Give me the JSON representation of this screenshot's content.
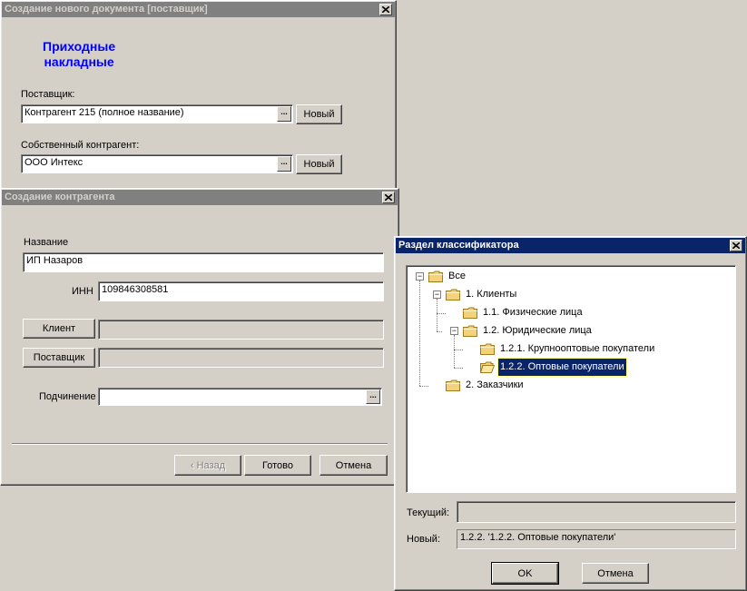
{
  "doc_window": {
    "title": "Создание нового документа [поставщик]",
    "heading": "Приходные\nнакладные",
    "supplier_label": "Поставщик:",
    "supplier_value": "Контрагент 215 (полное название)",
    "own_label": "Собственный контрагент:",
    "own_value": "ООО Интекс",
    "new_label": "Новый",
    "ellipsis": "..."
  },
  "contractor_window": {
    "title": "Создание контрагента",
    "name_label": "Название",
    "name_value": "ИП Назаров",
    "inn_label": "ИНН",
    "inn_value": "109846308581",
    "client_button": "Клиент",
    "supplier_button": "Поставщик",
    "subordination_label": "Подчинение",
    "back_button": "‹ Назад",
    "finish_button": "Готово",
    "cancel_button": "Отмена",
    "ellipsis": "..."
  },
  "classifier_window": {
    "title": "Раздел классификатора",
    "tree": [
      {
        "label": "Все",
        "level": 0,
        "expander": "−"
      },
      {
        "label": "1. Клиенты",
        "level": 1,
        "expander": "−"
      },
      {
        "label": "1.1. Физические лица",
        "level": 2,
        "expander": ""
      },
      {
        "label": "1.2. Юридические лица",
        "level": 2,
        "expander": "−"
      },
      {
        "label": "1.2.1. Крупнооптовые покупатели",
        "level": 3,
        "expander": ""
      },
      {
        "label": "1.2.2. Оптовые покупатели",
        "level": 3,
        "expander": "",
        "selected": true
      },
      {
        "label": "2. Заказчики",
        "level": 1,
        "expander": ""
      }
    ],
    "current_label": "Текущий:",
    "current_value": "",
    "new_label": "Новый:",
    "new_value": "1.2.2. '1.2.2. Оптовые покупатели'",
    "ok_button": "OK",
    "cancel_button": "Отмена"
  },
  "colors": {
    "active_title": "#0a246a",
    "inactive_title": "#808080",
    "heading_blue": "#0000ff",
    "face": "#d4d0c8"
  },
  "icons": [
    "close-icon",
    "folder-icon",
    "folder-open-icon",
    "ellipsis-icon"
  ]
}
